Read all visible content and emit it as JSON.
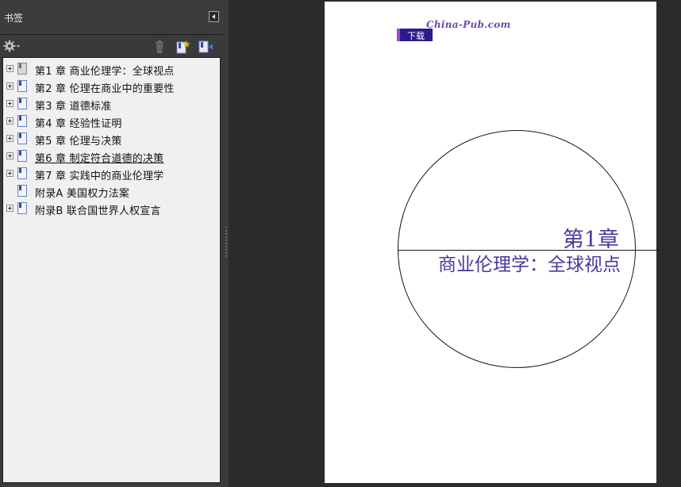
{
  "panel": {
    "title": "书签"
  },
  "bookmarks": [
    {
      "label": "第1 章 商业伦理学：全球视点",
      "has_children": true,
      "icon": "bookmark-page-gray-icon"
    },
    {
      "label": "第2 章 伦理在商业中的重要性",
      "has_children": true,
      "icon": "bookmark-page-icon"
    },
    {
      "label": "第3 章 道德标准",
      "has_children": true,
      "icon": "bookmark-page-icon"
    },
    {
      "label": "第4 章 经验性证明",
      "has_children": true,
      "icon": "bookmark-page-icon"
    },
    {
      "label": "第5 章 伦理与决策",
      "has_children": true,
      "icon": "bookmark-page-icon"
    },
    {
      "label": "第6 章 制定符合道德的决策",
      "has_children": true,
      "icon": "bookmark-page-icon",
      "underlined": true
    },
    {
      "label": "第7 章 实践中的商业伦理学",
      "has_children": true,
      "icon": "bookmark-page-icon"
    },
    {
      "label": "附录A 美国权力法案",
      "has_children": false,
      "icon": "bookmark-page-icon"
    },
    {
      "label": "附录B 联合国世界人权宣言",
      "has_children": true,
      "icon": "bookmark-page-icon"
    }
  ],
  "document": {
    "watermark_label": "下载",
    "watermark_logo": "China-Pub.com",
    "chapter_number": "第1章",
    "chapter_title": "商业伦理学：全球视点"
  },
  "colors": {
    "panel_bg": "#3a3a3a",
    "tree_bg": "#f0f0f0",
    "chapter_text": "#4a3a9c",
    "watermark_bg": "#2a1a8a"
  }
}
